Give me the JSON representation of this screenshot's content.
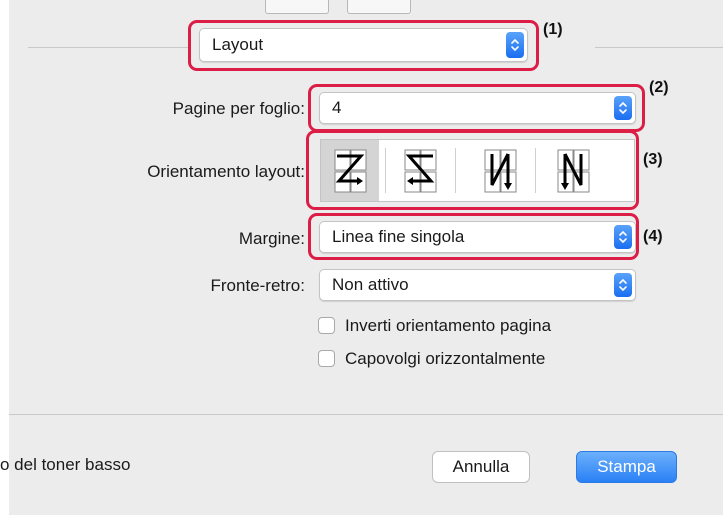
{
  "layout_menu": {
    "value": "Layout",
    "annotation": "(1)"
  },
  "pages_per_sheet": {
    "label": "Pagine per foglio:",
    "value": "4",
    "annotation": "(2)"
  },
  "layout_direction": {
    "label": "Orientamento layout:",
    "annotation": "(3)",
    "options": [
      "Z",
      "S reversed",
      "N reversed",
      "N"
    ],
    "selected": 0
  },
  "border": {
    "label": "Margine:",
    "value": "Linea fine singola",
    "annotation": "(4)"
  },
  "two_sided": {
    "label": "Fronte-retro:",
    "value": "Non attivo"
  },
  "checkboxes": {
    "reverse_orientation": {
      "label": "Inverti orientamento pagina",
      "checked": false
    },
    "flip_horizontal": {
      "label": "Capovolgi orizzontalmente",
      "checked": false
    }
  },
  "footer": {
    "truncated_text": "o del toner basso",
    "cancel_label": "Annulla",
    "print_label": "Stampa"
  },
  "colors": {
    "highlight": "#dc1e46",
    "accent": "#2a80f6",
    "panel_bg": "#ececec"
  }
}
